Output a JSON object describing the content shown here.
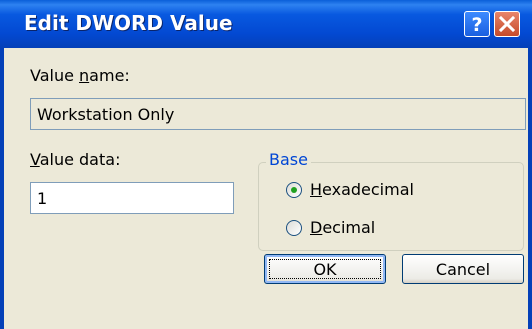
{
  "window": {
    "title": "Edit DWORD Value",
    "help_label": "?",
    "colors": {
      "title_bar": "#0349d2",
      "dialog_bg": "#ece9d8",
      "group_label": "#0046d5"
    }
  },
  "value_name": {
    "label": "Value name:",
    "value": "Workstation Only"
  },
  "value_data": {
    "label": "Value data:",
    "value": "1"
  },
  "base": {
    "legend": "Base",
    "options": [
      {
        "label": "Hexadecimal",
        "selected": true
      },
      {
        "label": "Decimal",
        "selected": false
      }
    ]
  },
  "buttons": {
    "ok": "OK",
    "cancel": "Cancel"
  },
  "icons": {
    "help": "help-icon",
    "close": "close-icon"
  }
}
